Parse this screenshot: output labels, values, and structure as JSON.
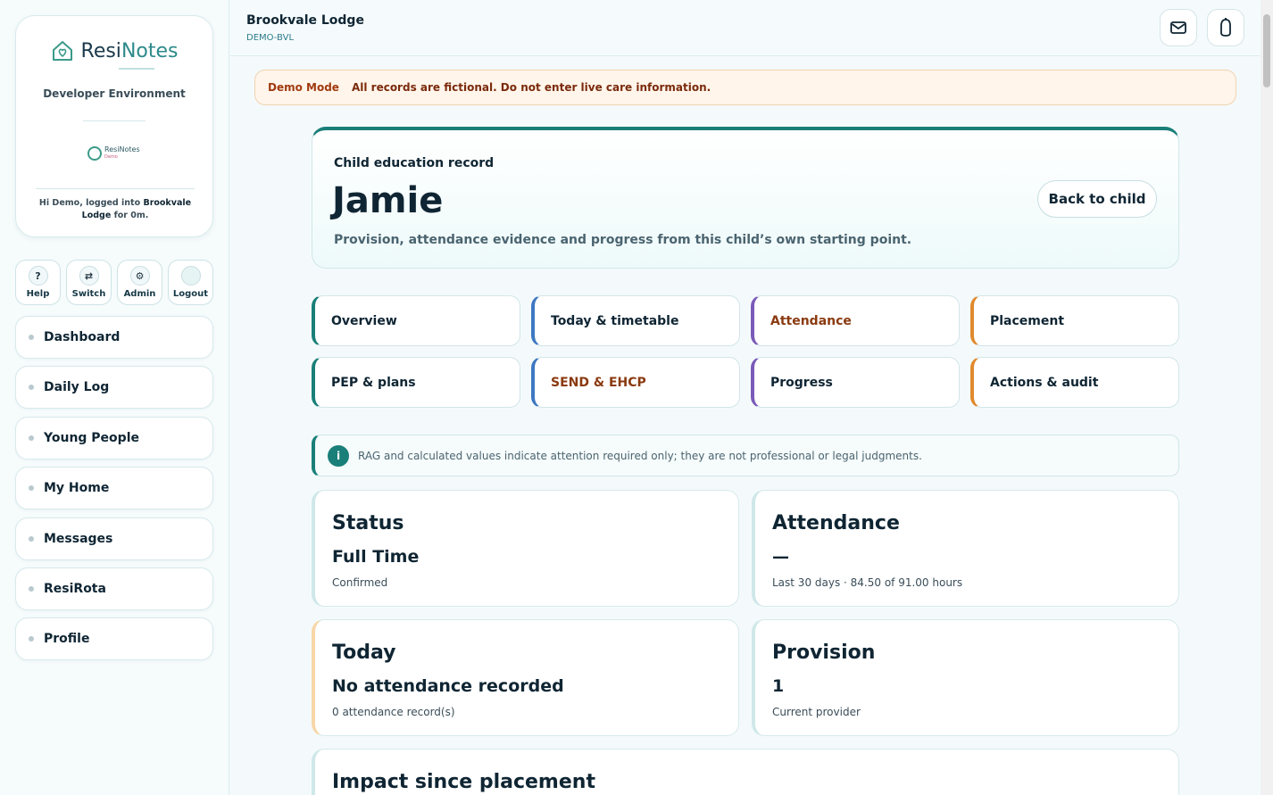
{
  "sidebar": {
    "logo_part1": "Resi",
    "logo_part2": "Notes",
    "environment": "Developer Environment",
    "mini_logo_text": "ResiNotes",
    "mini_logo_sub": "Demo",
    "greeting_prefix": "Hi Demo, logged into",
    "greeting_home": "Brookvale Lodge",
    "greeting_suffix": "for 0m.",
    "quick": [
      {
        "label": "Help",
        "icon": "?"
      },
      {
        "label": "Switch",
        "icon": "⇄"
      },
      {
        "label": "Admin",
        "icon": "⚙"
      },
      {
        "label": "Logout",
        "icon": ""
      }
    ],
    "nav": [
      "Dashboard",
      "Daily Log",
      "Young People",
      "My Home",
      "Messages",
      "ResiRota",
      "Profile"
    ]
  },
  "header": {
    "home_name": "Brookvale Lodge",
    "home_code": "DEMO-BVL"
  },
  "banner": {
    "mode": "Demo Mode",
    "text": "All records are fictional. Do not enter live care information."
  },
  "hero": {
    "kicker": "Child education record",
    "name": "Jamie",
    "subtitle": "Provision, attendance evidence and progress from this child’s own starting point.",
    "back_label": "Back to child"
  },
  "tabs": [
    {
      "label": "Overview",
      "accent": "#1a7f79",
      "text_color": "#0f2533"
    },
    {
      "label": "Today & timetable",
      "accent": "#3e78c2",
      "text_color": "#0f2533"
    },
    {
      "label": "Attendance",
      "accent": "#7b5bb8",
      "text_color": "#8a3a10"
    },
    {
      "label": "Placement",
      "accent": "#e08a2e",
      "text_color": "#0f2533"
    },
    {
      "label": "PEP & plans",
      "accent": "#1a7f79",
      "text_color": "#0f2533"
    },
    {
      "label": "SEND & EHCP",
      "accent": "#3e78c2",
      "text_color": "#8a3a10"
    },
    {
      "label": "Progress",
      "accent": "#7b5bb8",
      "text_color": "#0f2533"
    },
    {
      "label": "Actions & audit",
      "accent": "#e08a2e",
      "text_color": "#0f2533"
    }
  ],
  "info_text": "RAG and calculated values indicate attention required only; they are not professional or legal judgments.",
  "cards": [
    {
      "title": "Status",
      "value": "Full Time",
      "sub": "Confirmed",
      "accent": "#cfe7e8"
    },
    {
      "title": "Attendance",
      "value": "—",
      "sub": "Last 30 days · 84.50 of 91.00 hours",
      "accent": "#cfe7e8"
    },
    {
      "title": "Today",
      "value": "No attendance recorded",
      "sub": "0 attendance record(s)",
      "accent": "#f7d7a8"
    },
    {
      "title": "Provision",
      "value": "1",
      "sub": "Current provider",
      "accent": "#cfe7e8"
    }
  ],
  "impact_title": "Impact since placement"
}
